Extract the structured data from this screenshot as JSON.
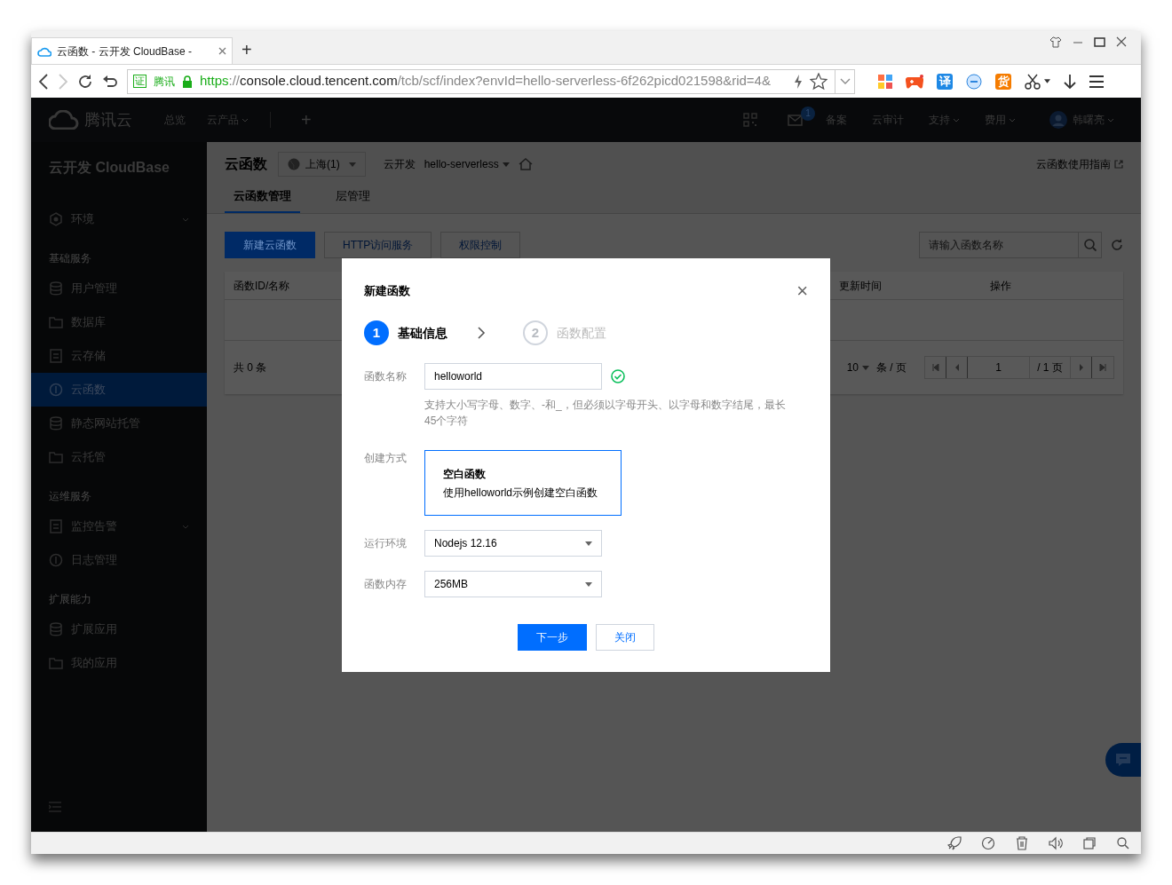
{
  "browser": {
    "tab": {
      "title": "云函数 - 云开发 CloudBase -",
      "selected": true
    },
    "new_tab": "+",
    "cert": {
      "mark": "证",
      "label": "腾讯"
    },
    "url": {
      "scheme": "https",
      "separator": "://",
      "host": "console.cloud.tencent.com",
      "path": "/tcb/scf/index?envId=hello-serverless-6f262picd021598&rid=4&"
    },
    "extensions": [
      {
        "kind": "grid"
      },
      {
        "kind": "game"
      },
      {
        "kind": "glyph",
        "text": "译",
        "color": "#1e88e5"
      },
      {
        "kind": "minus"
      },
      {
        "kind": "glyph",
        "text": "货",
        "color": "#f57c00"
      },
      {
        "kind": "scissors"
      },
      {
        "kind": "download"
      },
      {
        "kind": "menu"
      }
    ]
  },
  "topnav": {
    "logo": "腾讯云",
    "left": [
      {
        "label": "总览",
        "dropdown": false
      },
      {
        "label": "云产品",
        "dropdown": true
      }
    ],
    "add": "+",
    "mail_badge": "1",
    "right": [
      {
        "label": "备案",
        "dropdown": false
      },
      {
        "label": "云审计",
        "dropdown": false
      },
      {
        "label": "支持",
        "dropdown": true
      },
      {
        "label": "费用",
        "dropdown": true
      }
    ],
    "user": "韩曙亮"
  },
  "sidebar": {
    "title": "云开发 CloudBase",
    "sections": [
      {
        "items": [
          {
            "label": "环境",
            "selected": false,
            "expandable": true
          }
        ]
      },
      {
        "title": "基础服务",
        "items": [
          {
            "label": "用户管理",
            "selected": false,
            "expandable": false
          },
          {
            "label": "数据库",
            "selected": false,
            "expandable": false
          },
          {
            "label": "云存储",
            "selected": false,
            "expandable": false
          },
          {
            "label": "云函数",
            "selected": true,
            "expandable": false
          },
          {
            "label": "静态网站托管",
            "selected": false,
            "expandable": false
          },
          {
            "label": "云托管",
            "selected": false,
            "expandable": false
          }
        ]
      },
      {
        "title": "运维服务",
        "items": [
          {
            "label": "监控告警",
            "selected": false,
            "expandable": true
          },
          {
            "label": "日志管理",
            "selected": false,
            "expandable": false
          }
        ]
      },
      {
        "title": "扩展能力",
        "items": [
          {
            "label": "扩展应用",
            "selected": false,
            "expandable": false
          },
          {
            "label": "我的应用",
            "selected": false,
            "expandable": false
          }
        ]
      }
    ]
  },
  "header": {
    "title": "云函数",
    "region": "上海(1)",
    "env_label": "云开发",
    "env": "hello-serverless",
    "guide_link": "云函数使用指南"
  },
  "tabs": [
    {
      "label": "云函数管理",
      "selected": true
    },
    {
      "label": "层管理",
      "selected": false
    }
  ],
  "toolbar": {
    "buttons": [
      {
        "label": "新建云函数",
        "kind": "primary"
      },
      {
        "label": "HTTP访问服务",
        "kind": "default"
      },
      {
        "label": "权限控制",
        "kind": "default"
      }
    ],
    "search": {
      "placeholder": "请输入函数名称"
    }
  },
  "table": {
    "columns": [
      "函数ID/名称",
      "更新时间",
      "操作"
    ],
    "total": "共 0 条",
    "page_size": "10",
    "page_size_unit": "条 / 页",
    "page": "1",
    "page_total": "/ 1 页"
  },
  "modal": {
    "title": "新建函数",
    "close": "×",
    "steps": [
      {
        "number": "1",
        "label": "基础信息",
        "selected": true
      },
      {
        "number": "2",
        "label": "函数配置",
        "selected": false
      }
    ],
    "name_field": {
      "label": "函数名称",
      "value": "helloworld",
      "valid": true,
      "hint": "支持大小写字母、数字、-和_，但必须以字母开头、以字母和数字结尾，最长45个字符"
    },
    "create_method": {
      "label": "创建方式",
      "options": [
        {
          "title": "空白函数",
          "description": "使用helloworld示例创建空白函数",
          "selected": true
        }
      ]
    },
    "selects": [
      {
        "label": "运行环境",
        "value": "Nodejs 12.16"
      },
      {
        "label": "函数内存",
        "value": "256MB"
      }
    ],
    "buttons": [
      {
        "label": "下一步",
        "kind": "primary"
      },
      {
        "label": "关闭",
        "kind": "default"
      }
    ]
  }
}
